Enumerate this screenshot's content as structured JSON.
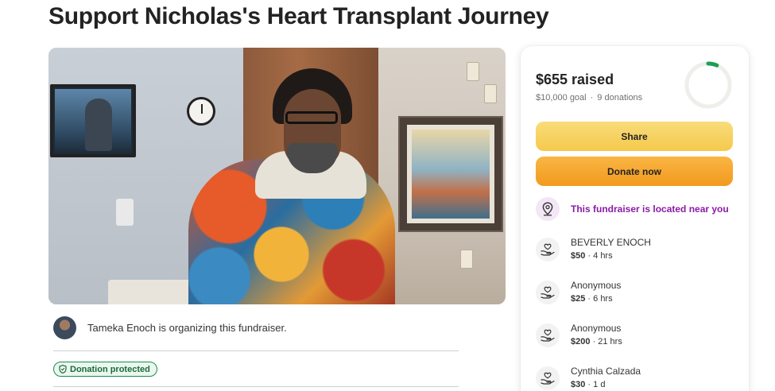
{
  "page": {
    "title": "Support Nicholas's Heart Transplant Journey"
  },
  "organizer": {
    "text": "Tameka Enoch is organizing this fundraiser."
  },
  "badge": {
    "label": "Donation protected"
  },
  "summary": {
    "raised": "$655 raised",
    "goal": "$10,000 goal",
    "separator": "·",
    "donations": "9 donations",
    "progress_fraction": 0.0655
  },
  "buttons": {
    "share": "Share",
    "donate": "Donate now"
  },
  "location": {
    "text": "This fundraiser is located near you"
  },
  "donors": [
    {
      "name": "BEVERLY ENOCH",
      "amount": "$50",
      "time": "4 hrs"
    },
    {
      "name": "Anonymous",
      "amount": "$25",
      "time": "6 hrs"
    },
    {
      "name": "Anonymous",
      "amount": "$200",
      "time": "21 hrs"
    },
    {
      "name": "Cynthia Calzada",
      "amount": "$30",
      "time": "1 d"
    }
  ],
  "colors": {
    "accent_green": "#1e8a4c",
    "share_yellow": "#f5c94c",
    "donate_orange": "#f29a1f",
    "location_purple": "#8a1ba6"
  },
  "icons": {
    "location": "location-pin-icon",
    "donor": "heart-hand-icon",
    "badge": "shield-icon"
  }
}
